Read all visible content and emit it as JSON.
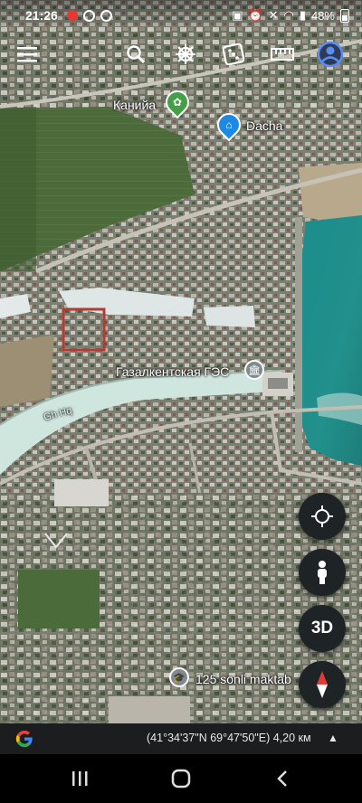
{
  "status_bar": {
    "time": "21:26",
    "battery": "48%"
  },
  "toolbar": {
    "icons": [
      "menu-icon",
      "search-icon",
      "voyager-wheel-icon",
      "dice-icon",
      "ruler-icon",
      "account-icon"
    ]
  },
  "map": {
    "places": [
      {
        "name": "Канийа"
      },
      {
        "name": "Dacha"
      },
      {
        "name": "Газалкентская ГЭС"
      },
      {
        "name": "125 sonli maktab"
      }
    ],
    "water_label": "Gh Hq",
    "colors": {
      "reservoir": "#1d8e8c",
      "canal": "#cfe6df",
      "green_pin": "#43a047",
      "blue_pin": "#1e88e5"
    }
  },
  "controls": {
    "button_3d": "3D",
    "icons": [
      "my-location-icon",
      "street-view-icon",
      "compass-icon"
    ]
  },
  "bottom_bar": {
    "coordinates": "(41°34'37\"N 69°47'50\"E) 4,20 км",
    "expand_symbol": "▲"
  },
  "nav_bar": {
    "buttons": [
      "recent-apps",
      "home",
      "back"
    ]
  }
}
